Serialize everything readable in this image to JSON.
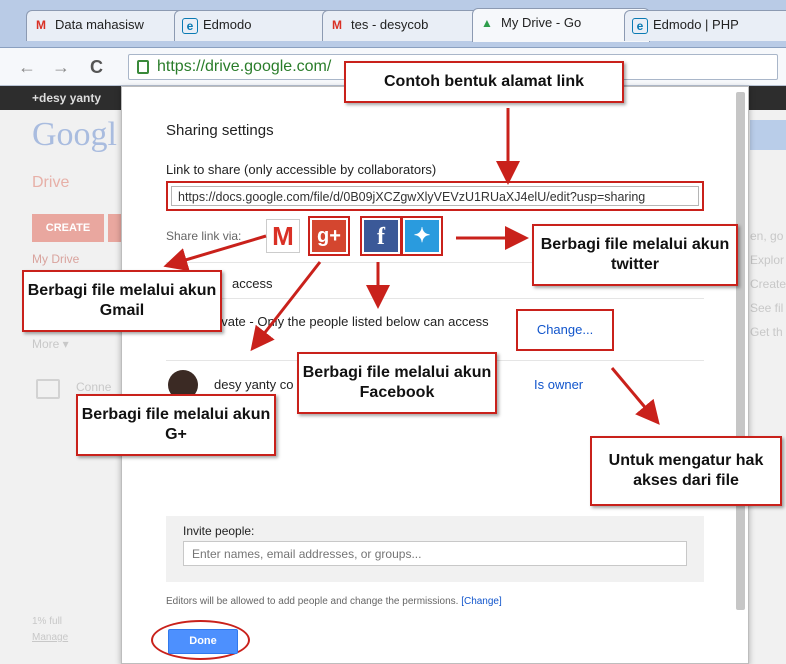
{
  "browser": {
    "tabs": [
      {
        "label": "Data mahasisw",
        "icon": "M"
      },
      {
        "label": "Edmodo",
        "icon": "e"
      },
      {
        "label": "tes - desycob",
        "icon": "M"
      },
      {
        "label": "My Drive - Go",
        "icon": "▲"
      },
      {
        "label": "Edmodo | PHP",
        "icon": "e"
      }
    ],
    "close_glyph": "×",
    "url": "https://drive.google.com/"
  },
  "background": {
    "user": "+desy yanty",
    "logo": "Googl",
    "drive": "Drive",
    "create": "CREATE",
    "my_drive": "My Drive",
    "more": "More ▾",
    "connect": "Conne",
    "storage": "1% full",
    "manage": "Manage",
    "right_items": [
      "en, go",
      "Explor",
      "Create",
      "See fil",
      "Get th"
    ]
  },
  "dialog": {
    "title": "Sharing settings",
    "link_label": "Link to share (only accessible by collaborators)",
    "link_value": "https://docs.google.com/file/d/0B09jXCZgwXlyVEVzU1RUaXJ4elU/edit?usp=sharing",
    "share_via": "Share link via:",
    "access_heading": "access",
    "access_private": "rivate - Only the people listed below can access",
    "change_link": "Change...",
    "owner_name": "desy yanty co",
    "owner_role": "Is owner",
    "invite_label": "Invite people:",
    "invite_placeholder": "Enter names, email addresses, or groups...",
    "editors_note": "Editors will be allowed to add people and change the permissions.",
    "editors_change": "[Change]",
    "done_label": "Done"
  },
  "callouts": {
    "link_format": "Contoh bentuk alamat link",
    "twitter": "Berbagi file melalui akun twitter",
    "gmail": "Berbagi file melalui akun Gmail",
    "facebook": "Berbagi file melalui akun Facebook",
    "gplus": "Berbagi file melalui akun G+",
    "access": "Untuk mengatur hak akses dari file"
  },
  "colors": {
    "annotation_red": "#c9211b",
    "done_blue": "#4d90fe",
    "link_blue": "#1155cc"
  }
}
